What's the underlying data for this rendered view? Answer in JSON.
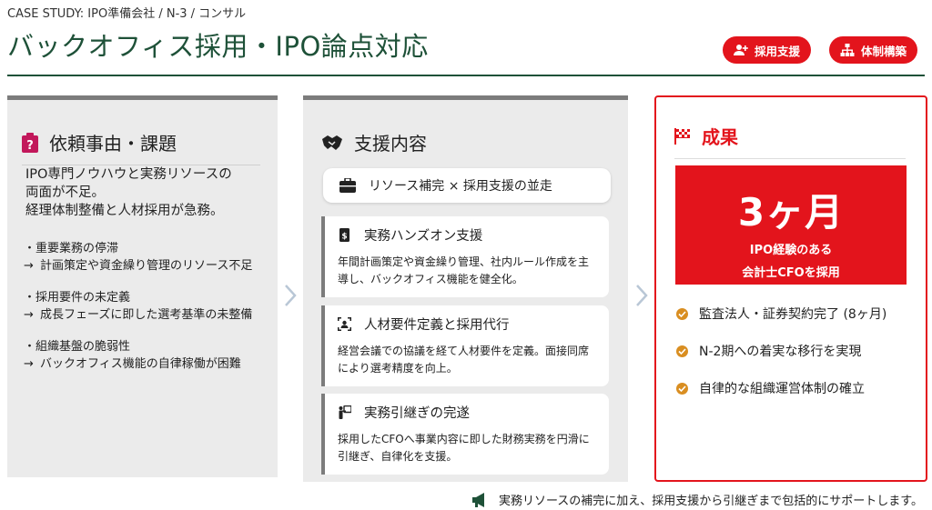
{
  "header": {
    "eyebrow": "CASE STUDY: IPO準備会社 / N-3 / コンサル",
    "title": "バックオフィス採用・IPO論点対応"
  },
  "tags": [
    {
      "label": "採用支援",
      "icon": "user-plus-icon"
    },
    {
      "label": "体制構築",
      "icon": "org-chart-icon"
    }
  ],
  "left": {
    "heading": "依頼事由・課題",
    "intro": [
      "IPO専門ノウハウと実務リソースの",
      "両面が不足。",
      "経理体制整備と人材採用が急務。"
    ],
    "issues": [
      {
        "point": "・重要業務の停滞",
        "detail": "計画策定や資金繰り管理のリソース不足"
      },
      {
        "point": "・採用要件の未定義",
        "detail": "成長フェーズに即した選考基準の未整備"
      },
      {
        "point": "・組織基盤の脆弱性",
        "detail": "バックオフィス機能の自律稼働が困難"
      }
    ],
    "arrow": "→"
  },
  "mid": {
    "heading": "支援内容",
    "lead": "リソース補完 × 採用支援の並走",
    "cards": [
      {
        "title": "実務ハンズオン支援",
        "body": "年間計画策定や資金繰り管理、社内ルール作成を主導し、バックオフィス機能を健全化。"
      },
      {
        "title": "人材要件定義と採用代行",
        "body": "経営会議での協議を経て人材要件を定義。面接同席により選考精度を向上。"
      },
      {
        "title": "実務引継ぎの完遂",
        "body": "採用したCFOへ事業内容に即した財務実務を円滑に引継ぎ、自律化を支援。"
      }
    ]
  },
  "right": {
    "heading": "成果",
    "big_value": "3ヶ月",
    "big_desc_1": "IPO経験のある",
    "big_desc_2": "会計士CFOを採用",
    "outcomes": [
      "監査法人・証券契約完了 (8ヶ月)",
      "N-2期への着実な移行を実現",
      "自律的な組織運営体制の確立"
    ]
  },
  "footer": {
    "text": "実務リソースの補完に加え、採用支援から引継ぎまで包括的にサポートします。"
  },
  "colors": {
    "accent_red": "#e3141c",
    "brand_green": "#1e5138",
    "check_orange": "#d98e21"
  }
}
